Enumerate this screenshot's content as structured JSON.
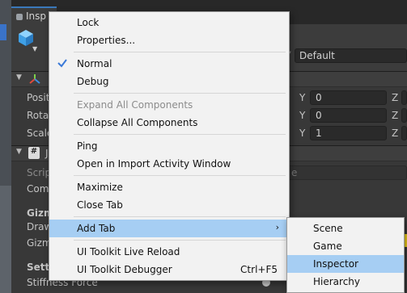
{
  "inspector": {
    "tab_label": "Insp",
    "tag_value": "Default",
    "transform": {
      "rows": [
        {
          "label": "Positi",
          "y_axis": "Y",
          "y_value": "0",
          "z_axis": "Z"
        },
        {
          "label": "Rotat",
          "y_axis": "Y",
          "y_value": "0",
          "z_axis": "Z"
        },
        {
          "label": "Scale",
          "y_axis": "Y",
          "y_value": "1",
          "z_axis": "Z"
        }
      ]
    },
    "script_section": {
      "header_partial": "J",
      "script_label": "Scrip",
      "script_field_tail": "e",
      "comp_label": "Com",
      "gizmo_label": "Gizm",
      "draw_label": "Draw",
      "gizmo2_label": "Gizm",
      "settings_label": "Setti",
      "stiffness_label": "Stiffness Force"
    }
  },
  "context_menu": {
    "items": [
      {
        "label": "Lock"
      },
      {
        "label": "Properties..."
      },
      {
        "label": "Normal",
        "checked": true
      },
      {
        "label": "Debug"
      },
      {
        "label": "Expand All Components",
        "disabled": true
      },
      {
        "label": "Collapse All Components"
      },
      {
        "label": "Ping"
      },
      {
        "label": "Open in Import Activity Window"
      },
      {
        "label": "Maximize"
      },
      {
        "label": "Close Tab"
      },
      {
        "label": "Add Tab",
        "submenu_arrow": "›",
        "highlighted": true
      },
      {
        "label": "UI Toolkit Live Reload"
      },
      {
        "label": "UI Toolkit Debugger",
        "shortcut": "Ctrl+F5"
      }
    ]
  },
  "submenu": {
    "items": [
      {
        "label": "Scene"
      },
      {
        "label": "Game"
      },
      {
        "label": "Inspector",
        "highlighted": true
      },
      {
        "label": "Hierarchy"
      }
    ]
  },
  "colors": {
    "highlight": "#a6cef3",
    "menu_bg": "#f2f2f2",
    "check": "#3a79d8",
    "accent_tab": "#3a79bb"
  }
}
